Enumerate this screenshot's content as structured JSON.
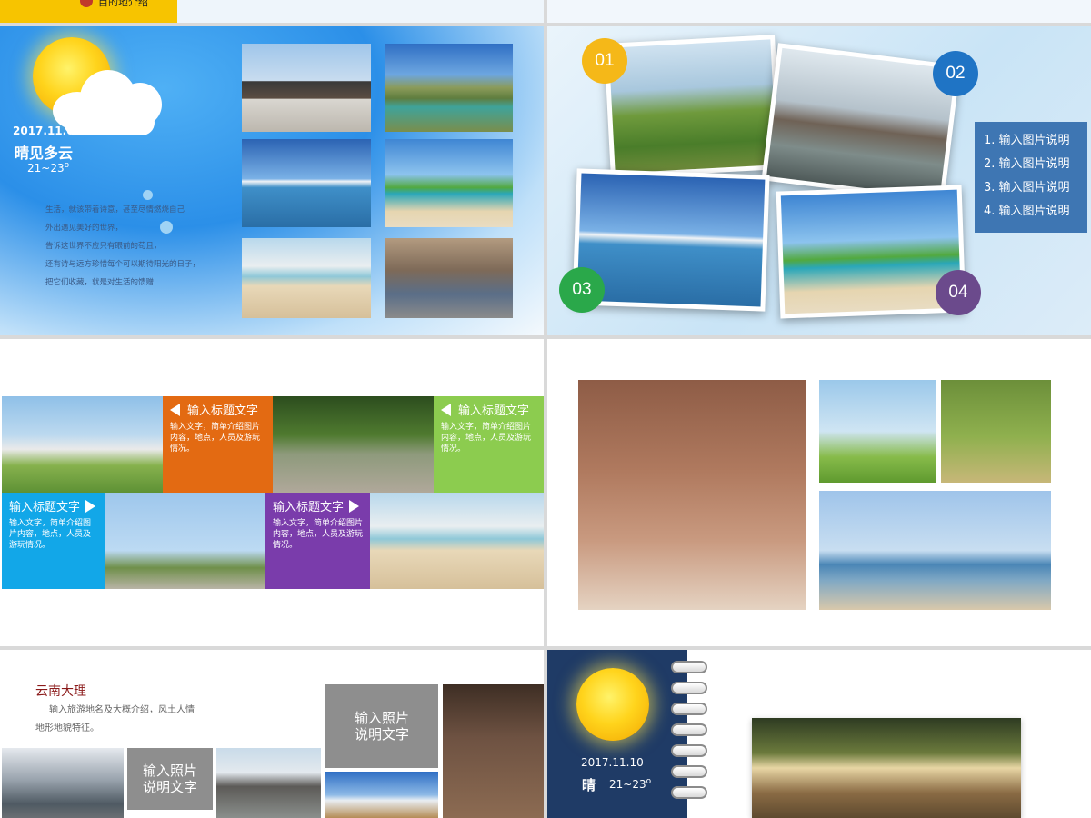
{
  "top_strip": {
    "button_label": "目的地介绍",
    "dot_color": "#c0392b"
  },
  "slide1": {
    "date": "2017.11.08",
    "weather": "晴见多云",
    "temp": "21~23",
    "degree": "o",
    "poem": [
      "生活，就该带着诗意，甚至尽情燃烧自己",
      "外出遇见美好的世界，",
      "告诉这世界不应只有眼前的苟且，",
      "还有诗与远方珍惜每个可以期待阳光的日子，",
      "把它们收藏，就是对生活的馈赠"
    ],
    "photos": [
      "temple",
      "river",
      "resort",
      "palm-bike",
      "beach-jump",
      "crowd"
    ]
  },
  "slide2": {
    "badges": [
      {
        "label": "01",
        "color": "#f5b818"
      },
      {
        "label": "02",
        "color": "#1f74c5"
      },
      {
        "label": "03",
        "color": "#2aa84a"
      },
      {
        "label": "04",
        "color": "#6b4a8c"
      }
    ],
    "captions": [
      "1. 输入图片说明",
      "2. 输入图片说明",
      "3. 输入图片说明",
      "4. 输入图片说明"
    ]
  },
  "slide3": {
    "tiles": [
      {
        "title": "输入标题文字",
        "body": "输入文字，简单介绍图片内容，地点，人员及游玩情况。",
        "color": "#e36a12"
      },
      {
        "title": "输入标题文字",
        "body": "输入文字，简单介绍图片内容，地点，人员及游玩情况。",
        "color": "#8ccc4f"
      },
      {
        "title": "输入标题文字",
        "body": "输入文字，简单介绍图片内容，地点，人员及游玩情况。",
        "color": "#12a7e8"
      },
      {
        "title": "输入标题文字",
        "body": "输入文字，简单介绍图片内容，地点，人员及游玩情况。",
        "color": "#7a3cab"
      }
    ]
  },
  "slide5": {
    "place": "云南大理",
    "intro_line1": "输入旅游地名及大概介绍，风土人情",
    "intro_line2": "地形地貌特征。",
    "box_a_line1": "输入照片",
    "box_a_line2": "说明文字",
    "box_b_line1": "输入照片",
    "box_b_line2": "说明文字"
  },
  "slide6": {
    "date": "2017.11.10",
    "weather": "晴",
    "temp": "21~23",
    "degree": "o",
    "panel_color": "#1f3b66"
  }
}
